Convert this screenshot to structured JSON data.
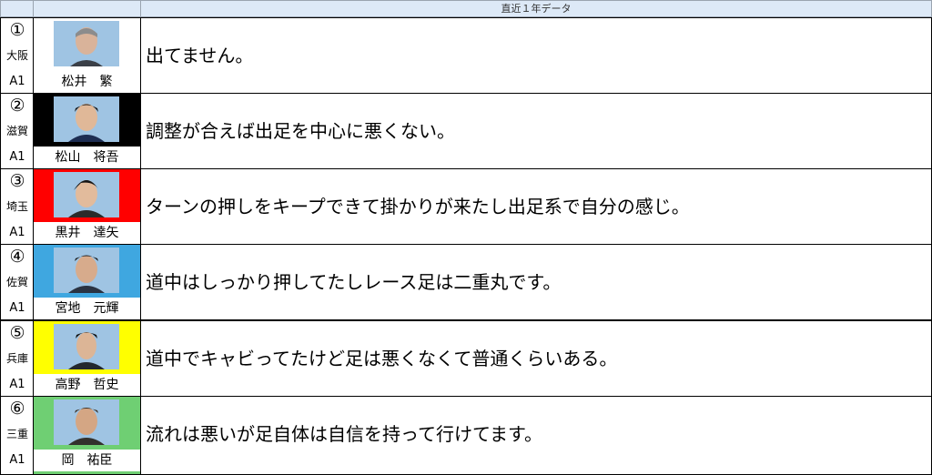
{
  "header": {
    "title": "直近１年データ"
  },
  "racers": [
    {
      "number": "①",
      "prefecture": "大阪",
      "class": "A1",
      "name": "松井　繁",
      "color": "#ffffff",
      "comment": "出てません。"
    },
    {
      "number": "②",
      "prefecture": "滋賀",
      "class": "A1",
      "name": "松山　将吾",
      "color": "#000000",
      "comment": "調整が合えば出足を中心に悪くない。"
    },
    {
      "number": "③",
      "prefecture": "埼玉",
      "class": "A1",
      "name": "黒井　達矢",
      "color": "#ff0000",
      "comment": "ターンの押しをキープできて掛かりが来たし出足系で自分の感じ。"
    },
    {
      "number": "④",
      "prefecture": "佐賀",
      "class": "A1",
      "name": "宮地　元輝",
      "color": "#3fa7e0",
      "comment": "道中はしっかり押してたしレース足は二重丸です。"
    },
    {
      "number": "⑤",
      "prefecture": "兵庫",
      "class": "A1",
      "name": "高野　哲史",
      "color": "#ffff00",
      "comment": "道中でキャビってたけど足は悪くなくて普通くらいある。"
    },
    {
      "number": "⑥",
      "prefecture": "三重",
      "class": "A1",
      "name": "岡　祐臣",
      "color": "#6fcf73",
      "comment": "流れは悪いが足自体は自信を持って行けてます。"
    }
  ]
}
